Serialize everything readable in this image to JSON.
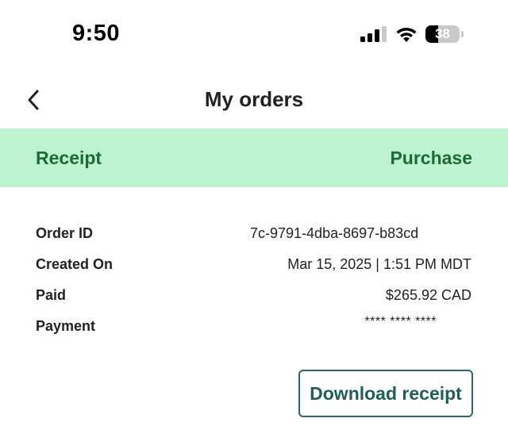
{
  "status_bar": {
    "time": "9:50",
    "battery_percent": "38",
    "battery_level": 0.38,
    "icons": [
      "signal-icon",
      "wifi-icon",
      "battery-icon"
    ]
  },
  "nav": {
    "back_icon": "chevron-left-icon",
    "title": "My orders"
  },
  "tabs": [
    {
      "label": "Receipt"
    },
    {
      "label": "Purchase"
    }
  ],
  "colors": {
    "tab_bar_bg": "#bdf3d1",
    "tab_text": "#1c6a3a",
    "button_border": "#2b6a67",
    "button_text": "#1f5e5a"
  },
  "order": {
    "order_id_label": "Order ID",
    "order_id_value": "7c-9791-4dba-8697-b83cd",
    "created_label": "Created On",
    "created_value": "Mar 15, 2025 | 1:51 PM MDT",
    "paid_label": "Paid",
    "paid_value": "$265.92 CAD",
    "payment_label": "Payment",
    "payment_value": "**** **** ****"
  },
  "actions": {
    "download_label": "Download receipt"
  }
}
